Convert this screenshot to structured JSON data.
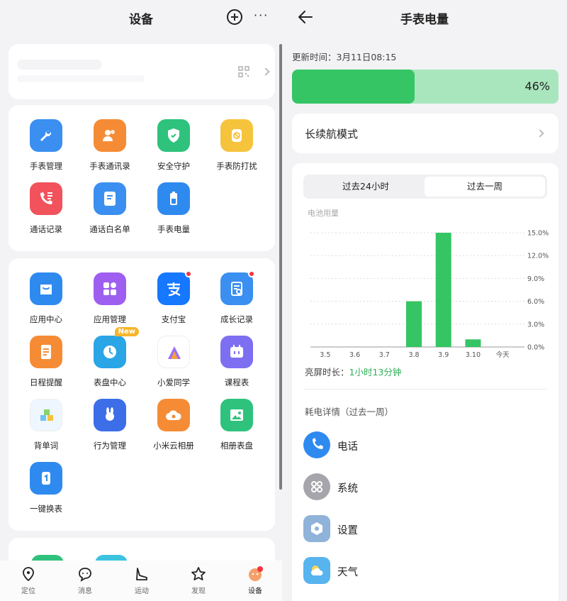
{
  "left": {
    "title": "设备",
    "apps_group1": [
      {
        "label": "手表管理",
        "icon": "wrench-icon",
        "color": "#3a8ff0"
      },
      {
        "label": "手表通讯录",
        "icon": "contacts-icon",
        "color": "#f58c35"
      },
      {
        "label": "安全守护",
        "icon": "shield-icon",
        "color": "#2fc27d"
      },
      {
        "label": "手表防打扰",
        "icon": "do-not-disturb-watch-icon",
        "color": "#f6c33d"
      },
      {
        "label": "通话记录",
        "icon": "call-log-icon",
        "color": "#f1525c"
      },
      {
        "label": "通话白名单",
        "icon": "whitelist-icon",
        "color": "#3b8ff1"
      },
      {
        "label": "手表电量",
        "icon": "battery-icon",
        "color": "#2f8af0"
      }
    ],
    "apps_group2": [
      {
        "label": "应用中心",
        "icon": "app-store-bag-icon",
        "color": "#2f8af0"
      },
      {
        "label": "应用管理",
        "icon": "app-grid-icon",
        "color": "#9e5ff0"
      },
      {
        "label": "支付宝",
        "icon": "alipay-icon",
        "color": "#1677ff"
      },
      {
        "label": "成长记录",
        "icon": "growth-record-icon",
        "color": "#3a8ff0"
      },
      {
        "label": "日程提醒",
        "icon": "schedule-icon",
        "color": "#f58c35"
      },
      {
        "label": "表盘中心",
        "icon": "watch-face-icon",
        "color": "#2aa5e6"
      },
      {
        "label": "小爱同学",
        "icon": "xiaoai-icon",
        "color": "#ffffff"
      },
      {
        "label": "课程表",
        "icon": "timetable-icon",
        "color": "#7d6ff2"
      },
      {
        "label": "背单词",
        "icon": "abc-blocks-icon",
        "color": "#eef6ff"
      },
      {
        "label": "行为管理",
        "icon": "rabbit-astronaut-icon",
        "color": "#3c6ee8"
      },
      {
        "label": "小米云相册",
        "icon": "cloud-album-icon",
        "color": "#f58c35"
      },
      {
        "label": "相册表盘",
        "icon": "photo-icon",
        "color": "#2fc27d"
      },
      {
        "label": "一键换表",
        "icon": "watch-swap-icon",
        "color": "#2f8af0"
      }
    ],
    "new_badge": "New",
    "tabs": [
      {
        "label": "定位",
        "icon": "location-pin-icon"
      },
      {
        "label": "消息",
        "icon": "message-bubble-icon"
      },
      {
        "label": "运动",
        "icon": "sport-shoe-icon"
      },
      {
        "label": "发现",
        "icon": "star-icon"
      },
      {
        "label": "设备",
        "icon": "device-avatar-icon"
      }
    ]
  },
  "right": {
    "title": "手表电量",
    "update_time": "更新时间：3月11日08:15",
    "battery": {
      "percent_label": "46%",
      "level": 0.46,
      "fill_color": "#35c564",
      "track_color": "#a9e6bd"
    },
    "mode_label": "长续航模式",
    "segments": [
      "过去24小时",
      "过去一周"
    ],
    "selected_segment": 1,
    "screen_time_label": "亮屏时长：",
    "screen_time_value": "1小时13分钟",
    "detail_heading": "耗电详情（过去一周）",
    "usage_items": [
      {
        "label": "电话",
        "icon": "phone-icon",
        "color": "#2f8af0"
      },
      {
        "label": "系统",
        "icon": "system-grid-icon",
        "color": "#a5a5ab"
      },
      {
        "label": "设置",
        "icon": "settings-hexagon-icon",
        "color": "#8fb3d9"
      },
      {
        "label": "天气",
        "icon": "weather-icon",
        "color": "#57b4ef"
      }
    ]
  },
  "chart_data": {
    "type": "bar",
    "title": "",
    "ylabel": "电池用量",
    "xlabel": "",
    "categories": [
      "3.5",
      "3.6",
      "3.7",
      "3.8",
      "3.9",
      "3.10",
      "今天"
    ],
    "values": [
      0,
      0,
      0,
      6.0,
      15.0,
      1.0,
      0
    ],
    "yticks": [
      "0.0%",
      "3.0%",
      "6.0%",
      "9.0%",
      "12.0%",
      "15.0%"
    ],
    "ylim": [
      0,
      15
    ],
    "grid": true,
    "bar_color": "#35c564"
  }
}
